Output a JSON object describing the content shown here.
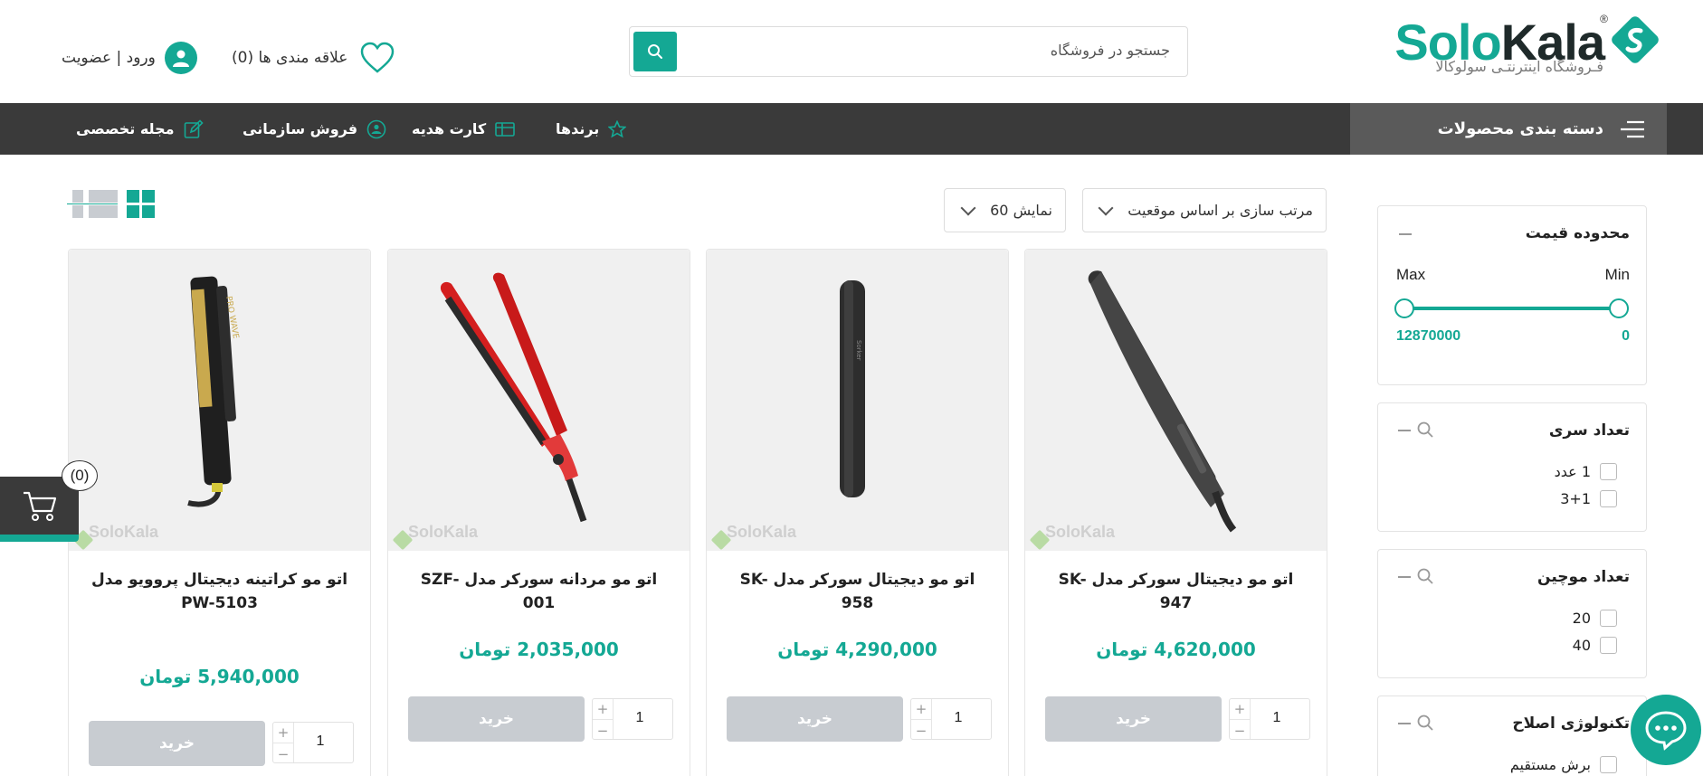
{
  "brand": {
    "name_part1": "Solo",
    "name_part2": "Kala",
    "registered": "®",
    "tagline": "فـروشگاه اینترنتـی سولوکالا",
    "accent_color": "#14a894",
    "dark_color": "#3a3a3a"
  },
  "header": {
    "search_placeholder": "جستجو در فروشگاه",
    "search_icon": "search-icon",
    "wishlist_label": "علاقه مندی ها (0)",
    "wishlist_icon": "heart-icon",
    "login_label": "ورود | عضویت",
    "login_icon": "user-icon"
  },
  "nav": {
    "categories_label": "دسته بندی محصولات",
    "items": [
      {
        "label": "برندها",
        "icon": "star-icon"
      },
      {
        "label": "کارت هدیه",
        "icon": "gift-card-icon"
      },
      {
        "label": "فروش سازمانی",
        "icon": "organization-icon"
      },
      {
        "label": "مجله تخصصی",
        "icon": "edit-icon"
      }
    ]
  },
  "filters": {
    "price": {
      "title": "محدوده قیمت",
      "min_label": "Min",
      "max_label": "Max",
      "min_value": "0",
      "max_value": "12870000"
    },
    "heads": {
      "title": "تعداد سری",
      "options": [
        {
          "label": "1 عدد"
        },
        {
          "label": "3+1"
        }
      ]
    },
    "waves": {
      "title": "تعداد موچین",
      "options": [
        {
          "label": "20"
        },
        {
          "label": "40"
        }
      ]
    },
    "tech": {
      "title": "تکنولوژی اصلاح",
      "options": [
        {
          "label": "برش مستقیم"
        }
      ]
    }
  },
  "toolbar": {
    "sort_label": "مرتب سازی بر اساس  موقعیت",
    "show_label": "نمایش  60"
  },
  "products": [
    {
      "title": "اتو مو دیجیتال سورکر مدل SK-947",
      "price": "4,620,000 تومان",
      "buy_label": "خرید",
      "qty": "1",
      "watermark": "SoloKala"
    },
    {
      "title": "اتو مو دیجیتال سورکر مدل SK-958",
      "price": "4,290,000 تومان",
      "buy_label": "خرید",
      "qty": "1",
      "watermark": "SoloKala"
    },
    {
      "title": "اتو مو مردانه سورکر مدل SZF-001",
      "price": "2,035,000 تومان",
      "buy_label": "خرید",
      "qty": "1",
      "watermark": "SoloKala"
    },
    {
      "title": "اتو مو کراتینه دیجیتال پروویو مدل PW-5103",
      "price": "5,940,000 تومان",
      "buy_label": "خرید",
      "qty": "1",
      "watermark": "SoloKala"
    }
  ],
  "qty_plus": "+",
  "qty_minus": "−",
  "cart": {
    "count": "(0)",
    "icon": "cart-icon"
  },
  "chat": {
    "icon": "chat-icon"
  }
}
